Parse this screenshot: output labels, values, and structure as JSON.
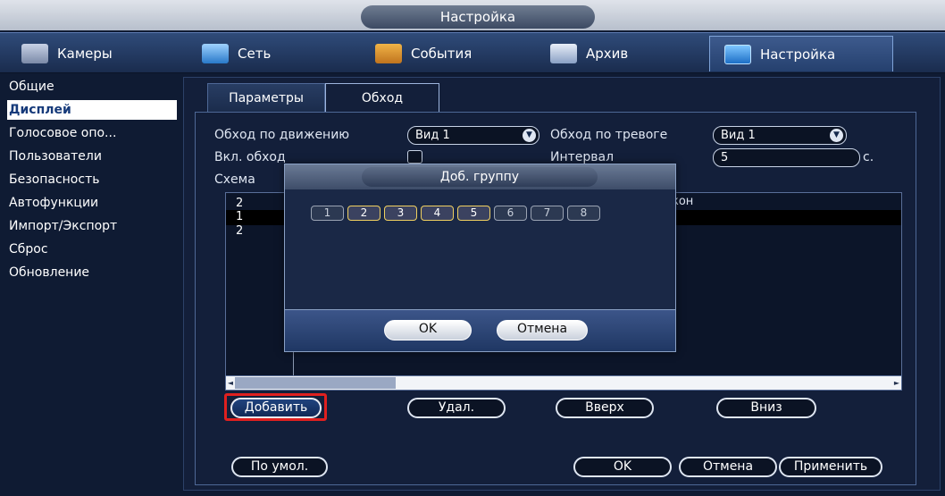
{
  "window": {
    "title": "Настройка"
  },
  "main_tabs": [
    {
      "label": "Камеры",
      "icon": "camera-icon"
    },
    {
      "label": "Сеть",
      "icon": "network-icon"
    },
    {
      "label": "События",
      "icon": "events-icon"
    },
    {
      "label": "Архив",
      "icon": "archive-icon"
    },
    {
      "label": "Настройка",
      "icon": "settings-icon"
    }
  ],
  "sidebar": {
    "items": [
      {
        "label": "Общие"
      },
      {
        "label": "Дисплей"
      },
      {
        "label": "Голосовое опо..."
      },
      {
        "label": "Пользователи"
      },
      {
        "label": "Безопасность"
      },
      {
        "label": "Автофункции"
      },
      {
        "label": "Импорт/Экспорт"
      },
      {
        "label": "Сброс"
      },
      {
        "label": "Обновление"
      }
    ],
    "selected": "Дисплей"
  },
  "sub_tabs": [
    {
      "label": "Параметры"
    },
    {
      "label": "Обход"
    }
  ],
  "form": {
    "motion_tour_label": "Обход по движению",
    "motion_tour_value": "Вид 1",
    "alarm_tour_label": "Обход по тревоге",
    "alarm_tour_value": "Вид 1",
    "enable_tour_label": "Вкл. обход",
    "interval_label": "Интервал",
    "interval_value": "5",
    "interval_unit": "с.",
    "scheme_label": "Схема",
    "column_suffix": "кон"
  },
  "list": {
    "rows": [
      "2",
      "1",
      "2"
    ]
  },
  "buttons": {
    "add": "Добавить",
    "delete": "Удал.",
    "up": "Вверх",
    "down": "Вниз",
    "default": "По умол.",
    "ok": "OK",
    "cancel": "Отмена",
    "apply": "Применить"
  },
  "modal": {
    "title": "Доб. группу",
    "channels": [
      {
        "label": "1",
        "checked": false
      },
      {
        "label": "2",
        "checked": true
      },
      {
        "label": "3",
        "checked": true
      },
      {
        "label": "4",
        "checked": true
      },
      {
        "label": "5",
        "checked": true
      },
      {
        "label": "6",
        "checked": false
      },
      {
        "label": "7",
        "checked": false
      },
      {
        "label": "8",
        "checked": false
      }
    ],
    "ok": "OK",
    "cancel": "Отмена"
  },
  "colors": {
    "highlight": "#e0201f",
    "accent": "#1d6fc6"
  }
}
